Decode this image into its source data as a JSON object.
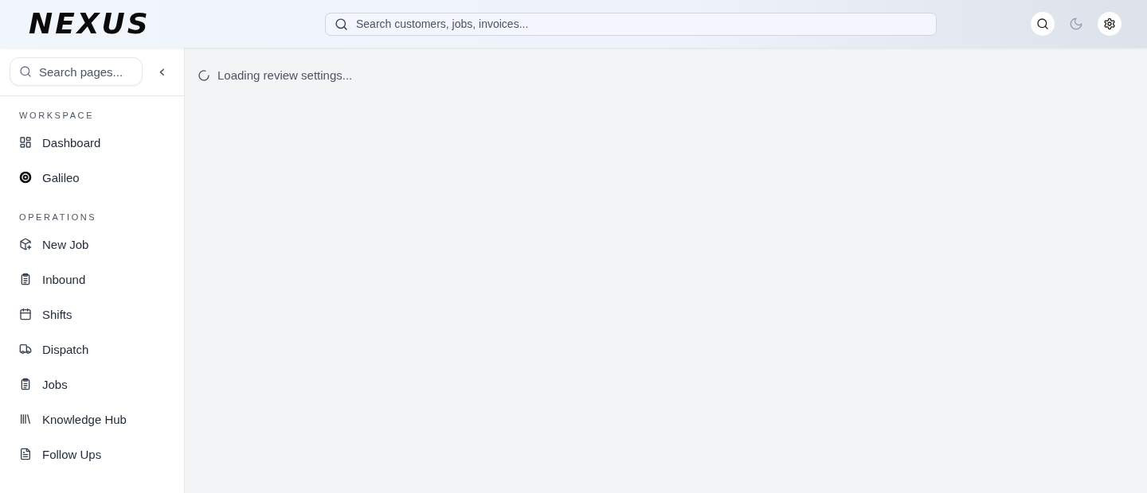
{
  "header": {
    "logo": "NEXUS",
    "search": {
      "placeholder": "Search customers, jobs, invoices..."
    }
  },
  "sidebar": {
    "search": {
      "placeholder": "Search pages..."
    },
    "collapse_button": "‹",
    "sections": [
      {
        "title": "WORKSPACE",
        "items": [
          {
            "label": "Dashboard",
            "kind": "grid"
          },
          {
            "label": "Galileo",
            "kind": "target"
          }
        ]
      },
      {
        "title": "OPERATIONS",
        "items": [
          {
            "label": "New Job",
            "kind": "package"
          },
          {
            "label": "Inbound",
            "kind": "clipboard"
          },
          {
            "label": "Shifts",
            "kind": "calendar"
          },
          {
            "label": "Dispatch",
            "kind": "truck"
          },
          {
            "label": "Jobs",
            "kind": "clipboard"
          },
          {
            "label": "Knowledge Hub",
            "kind": "library"
          },
          {
            "label": "Follow Ups",
            "kind": "document"
          }
        ]
      }
    ]
  },
  "main": {
    "status": "Loading review settings..."
  }
}
